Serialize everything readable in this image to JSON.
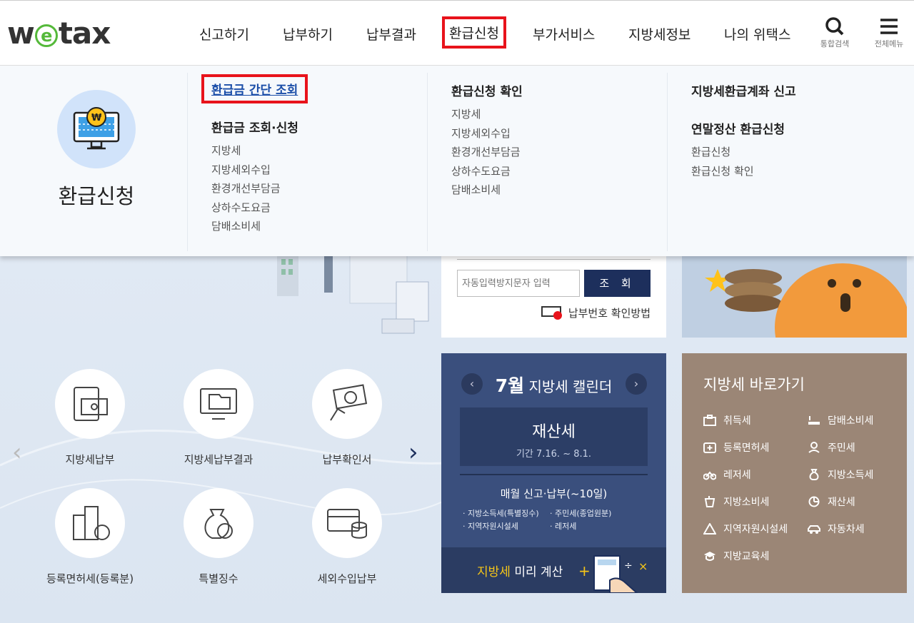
{
  "header": {
    "logo": {
      "left": "w",
      "e": "e",
      "right": "tax"
    },
    "nav": [
      "신고하기",
      "납부하기",
      "납부결과",
      "환급신청",
      "부가서비스",
      "지방세정보",
      "나의 위택스"
    ],
    "active_nav": "환급신청",
    "search_label": "통합검색",
    "menu_label": "전체메뉴"
  },
  "dropdown": {
    "title": "환급신청",
    "col1": {
      "highlight": "환급금 간단 조회",
      "heading": "환급금 조회·신청",
      "links": [
        "지방세",
        "지방세외수입",
        "환경개선부담금",
        "상하수도요금",
        "담배소비세"
      ]
    },
    "col2": {
      "heading": "환급신청 확인",
      "links": [
        "지방세",
        "지방세외수입",
        "환경개선부담금",
        "상하수도요금",
        "담배소비세"
      ]
    },
    "col3": {
      "heading1": "지방세환급계좌 신고",
      "heading2": "연말정산 환급신청",
      "links": [
        "환급신청",
        "환급신청 확인"
      ]
    }
  },
  "quick_menu": [
    "지방세납부",
    "지방세납부결과",
    "납부확인서",
    "등록면허세(등록분)",
    "특별징수",
    "세외수입납부"
  ],
  "lookup": {
    "placeholder": "자동입력방지문자 입력",
    "button": "조 회",
    "help": "납부번호 확인방법"
  },
  "calendar": {
    "month": "7월",
    "title": "지방세 캘린더",
    "tax": "재산세",
    "period": "기간 7.16. ~ 8.1.",
    "monthly": "매월 신고·납부(~10일)",
    "items": [
      "지방소득세(특별징수)",
      "주민세(종업원분)",
      "지역자원시설세",
      "레저세"
    ],
    "calc_hl": "지방세",
    "calc_rest": " 미리 계산"
  },
  "shortcuts": {
    "title": "지방세 바로가기",
    "items": [
      "취득세",
      "담배소비세",
      "등록면허세",
      "주민세",
      "레저세",
      "지방소득세",
      "지방소비세",
      "재산세",
      "지역자원시설세",
      "자동차세",
      "지방교육세"
    ]
  },
  "colors": {
    "accent": "#e8131b",
    "navy": "#1d2f5c",
    "calendar": "#3a4f7d",
    "shortcuts": "#9b8676",
    "logo_green": "#55b93a"
  }
}
